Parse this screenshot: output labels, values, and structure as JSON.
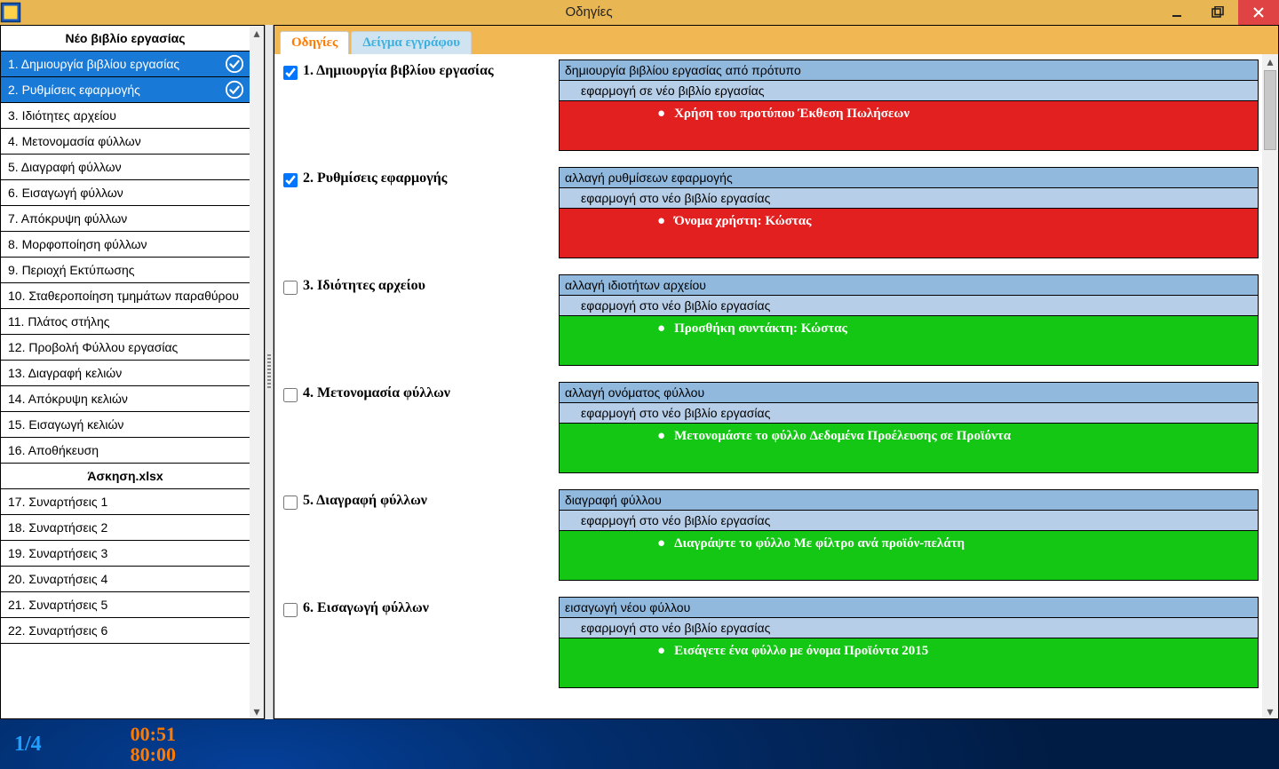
{
  "window": {
    "title": "Οδηγίες"
  },
  "sidebar": {
    "group1_title": "Νέο βιβλίο εργασίας",
    "group1_items": [
      {
        "label": "1. Δημιουργία βιβλίου εργασίας",
        "selected": true,
        "checked": true
      },
      {
        "label": "2. Ρυθμίσεις εφαρμογής",
        "selected": true,
        "checked": true
      },
      {
        "label": "3. Ιδιότητες αρχείου"
      },
      {
        "label": "4. Μετονομασία φύλλων"
      },
      {
        "label": "5. Διαγραφή φύλλων"
      },
      {
        "label": "6. Εισαγωγή φύλλων"
      },
      {
        "label": "7. Απόκρυψη φύλλων"
      },
      {
        "label": "8. Μορφοποίηση φύλλων"
      },
      {
        "label": "9. Περιοχή Εκτύπωσης"
      },
      {
        "label": "10. Σταθεροποίηση τμημάτων παραθύρου"
      },
      {
        "label": "11. Πλάτος στήλης"
      },
      {
        "label": "12. Προβολή Φύλλου εργασίας"
      },
      {
        "label": "13. Διαγραφή κελιών"
      },
      {
        "label": "14. Απόκρυψη κελιών"
      },
      {
        "label": "15. Εισαγωγή κελιών"
      },
      {
        "label": "16. Αποθήκευση"
      }
    ],
    "group2_title": "Άσκηση.xlsx",
    "group2_items": [
      {
        "label": "17. Συναρτήσεις 1"
      },
      {
        "label": "18. Συναρτήσεις 2"
      },
      {
        "label": "19. Συναρτήσεις 3"
      },
      {
        "label": "20. Συναρτήσεις 4"
      },
      {
        "label": "21. Συναρτήσεις 5"
      },
      {
        "label": "22. Συναρτήσεις 6"
      }
    ]
  },
  "tabs": [
    {
      "label": "Οδηγίες",
      "active": true
    },
    {
      "label": "Δείγμα εγγράφου",
      "active": false
    }
  ],
  "steps": [
    {
      "num": "1",
      "title": "Δημιουργία βιβλίου εργασίας",
      "checked": true,
      "header": "δημιουργία βιβλίου εργασίας από πρότυπο",
      "sub": "εφαρμογή σε νέο βιβλίο εργασίας",
      "detail_status": "red",
      "details": [
        {
          "pre": "Χρήση του προτύπου ",
          "bold": "Έκθεση Πωλήσεων"
        }
      ]
    },
    {
      "num": "2",
      "title": "Ρυθμίσεις εφαρμογής",
      "checked": true,
      "header": "αλλαγή ρυθμίσεων εφαρμογής",
      "sub": "εφαρμογή στο νέο βιβλίο εργασίας",
      "detail_status": "red",
      "details": [
        {
          "pre": "Όνομα χρήστη: ",
          "bold": "Κώστας"
        }
      ]
    },
    {
      "num": "3",
      "title": "Ιδιότητες αρχείου",
      "checked": false,
      "header": "αλλαγή ιδιοτήτων αρχείου",
      "sub": "εφαρμογή στο νέο βιβλίο εργασίας",
      "detail_status": "green",
      "details": [
        {
          "pre": "Προσθήκη συντάκτη: ",
          "bold": "Κώστας"
        }
      ]
    },
    {
      "num": "4",
      "title": "Μετονομασία φύλλων",
      "checked": false,
      "header": "αλλαγή ονόματος φύλλου",
      "sub": "εφαρμογή στο νέο βιβλίο εργασίας",
      "detail_status": "green",
      "details": [
        {
          "pre": "Μετονομάστε το φύλλο ",
          "bold": "Δεδομένα Προέλευσης",
          "post": " σε ",
          "bold2": "Προϊόντα"
        }
      ]
    },
    {
      "num": "5",
      "title": "Διαγραφή φύλλων",
      "checked": false,
      "header": "διαγραφή φύλλου",
      "sub": "εφαρμογή στο νέο βιβλίο εργασίας",
      "detail_status": "green",
      "details": [
        {
          "pre": "Διαγράψτε το φύλλο ",
          "bold": "Με φίλτρο ανά προϊόν-πελάτη"
        }
      ]
    },
    {
      "num": "6",
      "title": "Εισαγωγή φύλλων",
      "checked": false,
      "header": "εισαγωγή νέου φύλλου",
      "sub": "εφαρμογή στο νέο βιβλίο εργασίας",
      "detail_status": "green",
      "details": [
        {
          "pre": "Εισάγετε ένα φύλλο με όνομα ",
          "bold": "Προϊόντα 2015"
        }
      ]
    }
  ],
  "footer": {
    "position": "1/4",
    "elapsed": "00:51",
    "total": "80:00"
  }
}
